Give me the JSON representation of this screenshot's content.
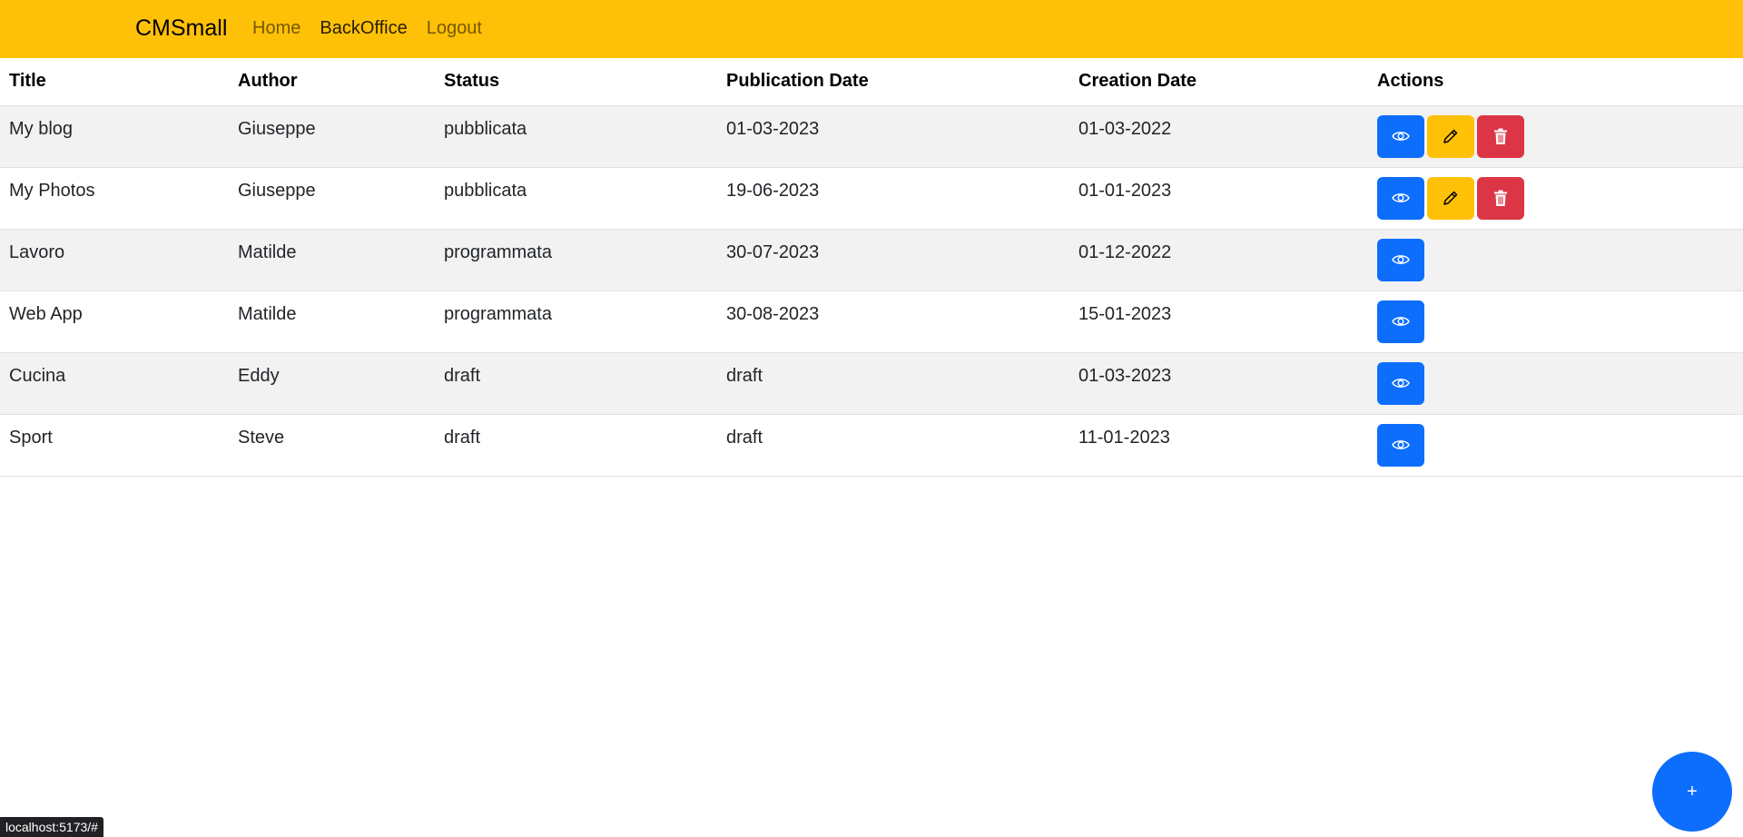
{
  "navbar": {
    "brand": "CMSmall",
    "links": [
      {
        "label": "Home"
      },
      {
        "label": "BackOffice"
      },
      {
        "label": "Logout"
      }
    ],
    "background": "#ffc107"
  },
  "table": {
    "headers": [
      "Title",
      "Author",
      "Status",
      "Publication Date",
      "Creation Date",
      "Actions"
    ],
    "rows": [
      {
        "title": "My blog",
        "author": "Giuseppe",
        "status": "pubblicata",
        "publication_date": "01-03-2023",
        "creation_date": "01-03-2022",
        "actions": [
          "view",
          "edit",
          "delete"
        ]
      },
      {
        "title": "My Photos",
        "author": "Giuseppe",
        "status": "pubblicata",
        "publication_date": "19-06-2023",
        "creation_date": "01-01-2023",
        "actions": [
          "view",
          "edit",
          "delete"
        ]
      },
      {
        "title": "Lavoro",
        "author": "Matilde",
        "status": "programmata",
        "publication_date": "30-07-2023",
        "creation_date": "01-12-2022",
        "actions": [
          "view"
        ]
      },
      {
        "title": "Web App",
        "author": "Matilde",
        "status": "programmata",
        "publication_date": "30-08-2023",
        "creation_date": "15-01-2023",
        "actions": [
          "view"
        ]
      },
      {
        "title": "Cucina",
        "author": "Eddy",
        "status": "draft",
        "publication_date": "draft",
        "creation_date": "01-03-2023",
        "actions": [
          "view"
        ]
      },
      {
        "title": "Sport",
        "author": "Steve",
        "status": "draft",
        "publication_date": "draft",
        "creation_date": "11-01-2023",
        "actions": [
          "view"
        ]
      }
    ],
    "action_icons": {
      "view": "eye-icon",
      "edit": "pencil-icon",
      "delete": "trash-icon"
    },
    "action_colors": {
      "view": "#0d6efd",
      "edit": "#ffc107",
      "delete": "#dc3545"
    }
  },
  "fab": {
    "label": "+",
    "color": "#0d6efd"
  },
  "status_bar": {
    "url": "localhost:5173/#"
  }
}
